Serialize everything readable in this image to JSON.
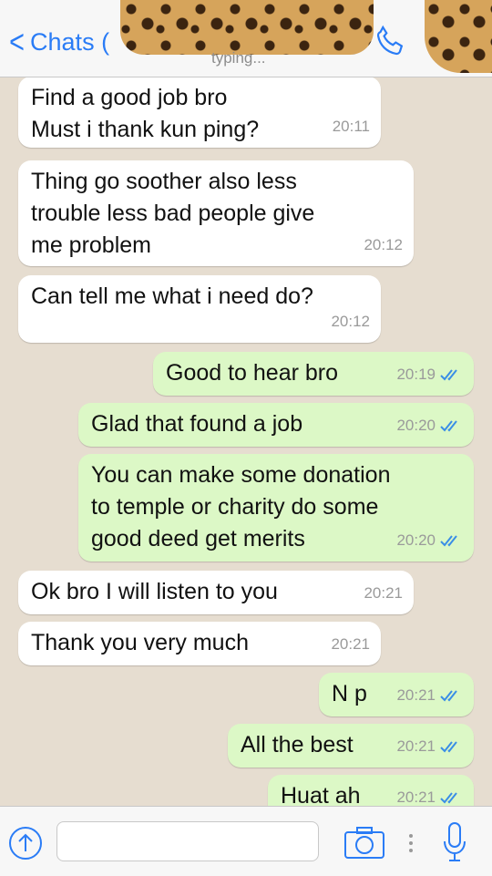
{
  "header": {
    "back_label": "Chats (",
    "status": "typing..."
  },
  "messages": [
    {
      "dir": "in",
      "text": "Find a good job bro\nMust i thank kun ping?",
      "time": "20:11"
    },
    {
      "dir": "in",
      "text": "Thing go soother also less\ntrouble less bad people give\nme problem",
      "time": "20:12"
    },
    {
      "dir": "in",
      "text": "Can tell me what i need do?",
      "time": "20:12"
    },
    {
      "dir": "out",
      "text": "Good to hear bro",
      "time": "20:19"
    },
    {
      "dir": "out",
      "text": "Glad that found a job",
      "time": "20:20"
    },
    {
      "dir": "out",
      "text": "You can make some donation\nto temple or charity do some\ngood deed get merits",
      "time": "20:20"
    },
    {
      "dir": "in",
      "text": "Ok bro I will listen to you",
      "time": "20:21"
    },
    {
      "dir": "in",
      "text": "Thank you very much",
      "time": "20:21"
    },
    {
      "dir": "out",
      "text": "N p",
      "time": "20:21"
    },
    {
      "dir": "out",
      "text": "All the best",
      "time": "20:21"
    },
    {
      "dir": "out",
      "text": "Huat ah",
      "time": "20:21"
    }
  ],
  "colors": {
    "accent": "#2a7cf6",
    "incoming_bubble": "#ffffff",
    "outgoing_bubble": "#dcf8c6",
    "read_ticks": "#3a8ee6"
  },
  "icons": {
    "back": "chevron-left-icon",
    "call": "phone-icon",
    "upload": "upload-arrow-icon",
    "camera": "camera-icon",
    "more": "vertical-dots-icon",
    "mic": "microphone-icon"
  }
}
